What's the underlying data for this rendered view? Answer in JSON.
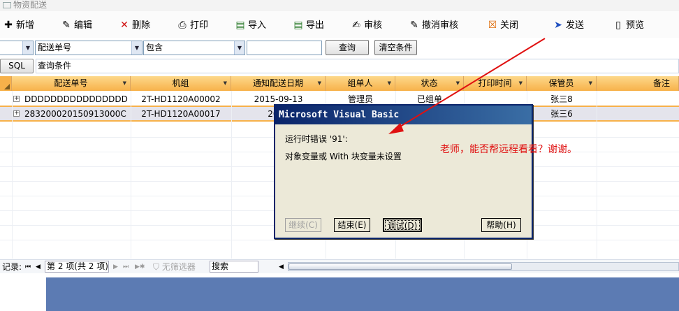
{
  "window": {
    "title": "物资配送"
  },
  "toolbar": {
    "items": [
      {
        "label": "新增",
        "icon": "new-icon"
      },
      {
        "label": "编辑",
        "icon": "edit-icon"
      },
      {
        "label": "删除",
        "icon": "delete-icon"
      },
      {
        "label": "打印",
        "icon": "print-icon"
      },
      {
        "label": "导入",
        "icon": "import-icon"
      },
      {
        "label": "导出",
        "icon": "export-icon"
      },
      {
        "label": "审核",
        "icon": "approve-icon"
      },
      {
        "label": "撤消审核",
        "icon": "unapprove-icon"
      },
      {
        "label": "关闭",
        "icon": "close-icon"
      },
      {
        "label": "发送",
        "icon": "send-icon"
      },
      {
        "label": "预览",
        "icon": "preview-icon"
      }
    ]
  },
  "filter": {
    "field_value": "配送单号",
    "operator_value": "包含",
    "search_value": "",
    "query_button": "查询",
    "clear_button": "清空条件"
  },
  "sql": {
    "button": "SQL",
    "label": "查询条件"
  },
  "grid": {
    "columns": [
      "配送单号",
      "机组",
      "通知配送日期",
      "组单人",
      "状态",
      "打印时间",
      "保管员",
      "备注"
    ],
    "rows": [
      [
        "DDDDDDDDDDDDDDDD",
        "2T-HD1120A00002",
        "2015-09-13",
        "管理员",
        "已组单",
        "",
        "张三8",
        ""
      ],
      [
        "283200020150913000C",
        "2T-HD1120A00017",
        "2015",
        "",
        "",
        "",
        "张三6",
        ""
      ]
    ]
  },
  "navigator": {
    "record_label": "记录:",
    "page_text": "第 2 项(共 2 项)",
    "filter_text": "无筛选器",
    "search_text": "搜索"
  },
  "dialog": {
    "title": "Microsoft Visual Basic",
    "message1": "运行时错误 '91':",
    "message2": "对象变量或 With 块变量未设置",
    "buttons": {
      "continue": "继续(C)",
      "end": "结束(E)",
      "debug": "调试(D)",
      "help": "帮助(H)"
    }
  },
  "annotation": {
    "text": "老师，能否帮远程看看？谢谢。",
    "color": "#e01010"
  },
  "colors": {
    "header": "#f7b14a",
    "dialog_title": "#0a246a",
    "bottom_panel": "#5c7bb3"
  }
}
